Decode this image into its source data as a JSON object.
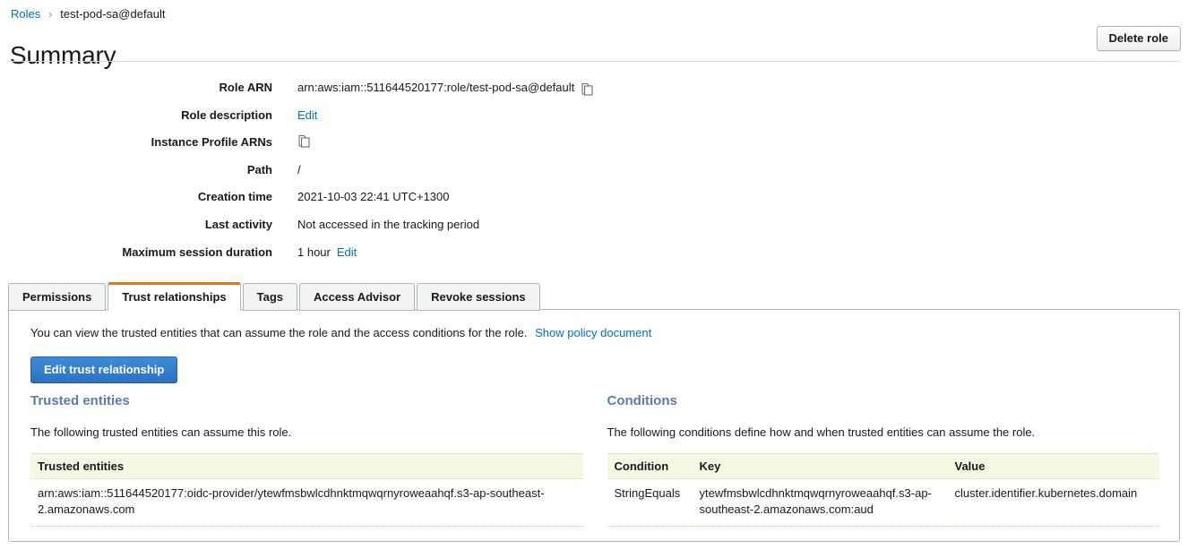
{
  "breadcrumb": {
    "root_label": "Roles",
    "separator": "›",
    "current_label": "test-pod-sa@default"
  },
  "header": {
    "title": "Summary",
    "delete_button_label": "Delete role"
  },
  "details": [
    {
      "label": "Role ARN",
      "value": "arn:aws:iam::511644520177:role/test-pod-sa@default",
      "icon": "copy-icon"
    },
    {
      "label": "Role description",
      "link": "Edit"
    },
    {
      "label": "Instance Profile ARNs",
      "value": "",
      "icon": "copy-icon"
    },
    {
      "label": "Path",
      "value": "/"
    },
    {
      "label": "Creation time",
      "value": "2021-10-03 22:41 UTC+1300"
    },
    {
      "label": "Last activity",
      "value": "Not accessed in the tracking period"
    },
    {
      "label": "Maximum session duration",
      "value": "1 hour",
      "link": "Edit"
    }
  ],
  "tabs": [
    {
      "label": "Permissions",
      "active": false
    },
    {
      "label": "Trust relationships",
      "active": true
    },
    {
      "label": "Tags",
      "active": false
    },
    {
      "label": "Access Advisor",
      "active": false
    },
    {
      "label": "Revoke sessions",
      "active": false
    }
  ],
  "panel": {
    "intro_text": "You can view the trusted entities that can assume the role and the access conditions for the role.",
    "intro_link": "Show policy document",
    "edit_button_label": "Edit trust relationship",
    "trusted_entities": {
      "heading": "Trusted entities",
      "subtitle": "The following trusted entities can assume this role.",
      "column_header": "Trusted entities",
      "rows": [
        "arn:aws:iam::511644520177:oidc-provider/ytewfmsbwlcdhnktmqwqrnyroweaahqf.s3-ap-southeast-2.amazonaws.com"
      ]
    },
    "conditions": {
      "heading": "Conditions",
      "subtitle": "The following conditions define how and when trusted entities can assume the role.",
      "columns": [
        "Condition",
        "Key",
        "Value"
      ],
      "rows": [
        {
          "condition": "StringEquals",
          "key": "ytewfmsbwlcdhnktmqwqrnyroweaahqf.s3-ap-southeast-2.amazonaws.com:aud",
          "value": "cluster.identifier.kubernetes.domain"
        }
      ]
    }
  },
  "colors": {
    "link": "#0073bb",
    "active_tab_accent": "#ec7211",
    "section_heading": "#5c7ab0",
    "table_header_bg": "#f7f8e3",
    "primary_button": "#2a72c6"
  }
}
